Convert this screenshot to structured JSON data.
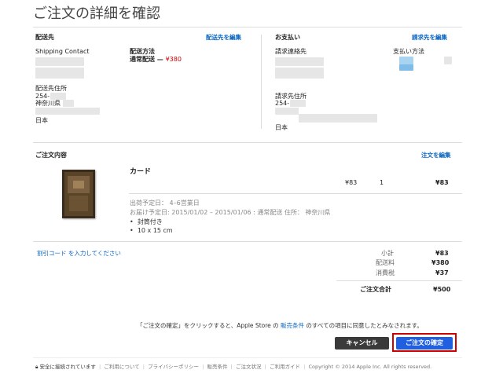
{
  "page_title": "ご注文の詳細を確認",
  "shipping": {
    "heading": "配送先",
    "edit_link": "配送先を編集",
    "contact_label": "Shipping Contact",
    "method_label": "配送方法",
    "method_value": "通常配送 — ",
    "method_price": "¥380",
    "address_label": "配送先住所",
    "postal": "254-",
    "prefecture": "神奈川県",
    "country": "日本"
  },
  "payment": {
    "heading": "お支払い",
    "edit_link": "請求先を編集",
    "contact_label": "請求連絡先",
    "method_label": "支払い方法",
    "address_label": "請求先住所",
    "postal": "254-",
    "country": "日本"
  },
  "order": {
    "heading": "ご注文内容",
    "edit_link": "注文を編集",
    "item_name": "カード",
    "unit_price": "¥83",
    "quantity": "1",
    "item_total": "¥83",
    "ship_estimate": "出荷予定日： 4–6営業日",
    "delivery_estimate": "お届け予定日: 2015/01/02 – 2015/01/06 : 通常配送 住所： 神奈川県",
    "bullets": [
      "封筒付き",
      "10 x 15 cm"
    ]
  },
  "promo_link": "割引コード を入力してください",
  "summary": {
    "subtotal_label": "小計",
    "subtotal_value": "¥83",
    "shipping_label": "配送料",
    "shipping_value": "¥380",
    "tax_label": "消費税",
    "tax_value": "¥37",
    "total_label": "ご注文合計",
    "total_value": "¥500"
  },
  "consent": {
    "before": "「ご注文の確定」をクリックすると、Apple Store の ",
    "link": "販売条件",
    "after": " のすべての項目に同意したとみなされます。"
  },
  "buttons": {
    "cancel": "キャンセル",
    "confirm": "ご注文の確定"
  },
  "footer": {
    "secure": "安全に接続されています",
    "links": [
      "ご利用について",
      "プライバシーポリシー",
      "販売条件",
      "ご注文状況",
      "ご利用ガイド"
    ],
    "copyright": "Copyright © 2014 Apple Inc. All rights reserved."
  },
  "colors": {
    "link": "#0a66c2",
    "price_red": "#cc0000",
    "confirm_button": "#1f5fe0",
    "cancel_button": "#3a3a3a",
    "highlight_border": "#d00000"
  }
}
